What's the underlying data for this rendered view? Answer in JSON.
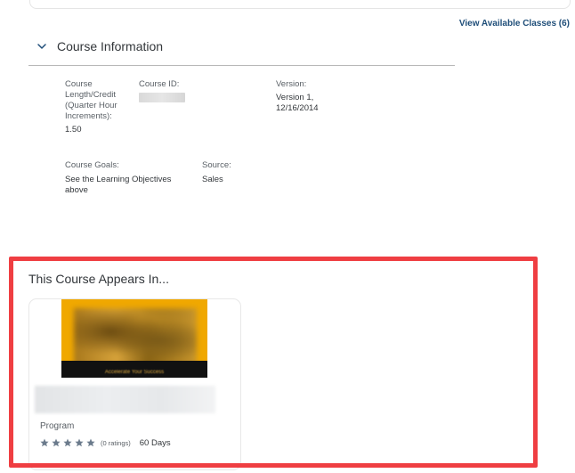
{
  "header": {
    "view_classes_label": "View Available Classes (6)"
  },
  "course_info": {
    "section_title": "Course Information",
    "length_label": "Course Length/Credit (Quarter Hour Increments):",
    "length_value": "1.50",
    "id_label": "Course ID:",
    "version_label": "Version:",
    "version_value": "Version 1, 12/16/2014",
    "goals_label": "Course Goals:",
    "goals_value": "See the Learning Objectives above",
    "source_label": "Source:",
    "source_value": "Sales"
  },
  "appears_in": {
    "title": "This Course Appears In...",
    "card": {
      "type": "Program",
      "ratings_count": "(0 ratings)",
      "duration": "60 Days",
      "stars": 5,
      "thumb_caption": "Accelerate Your Success"
    }
  },
  "colors": {
    "highlight": "#ef3e42",
    "link": "#1f4e79",
    "thumb_bg": "#f0a800",
    "star": "#6b7b8c"
  },
  "icons": {
    "chevron": "chevron-down-icon",
    "star": "star-icon"
  }
}
